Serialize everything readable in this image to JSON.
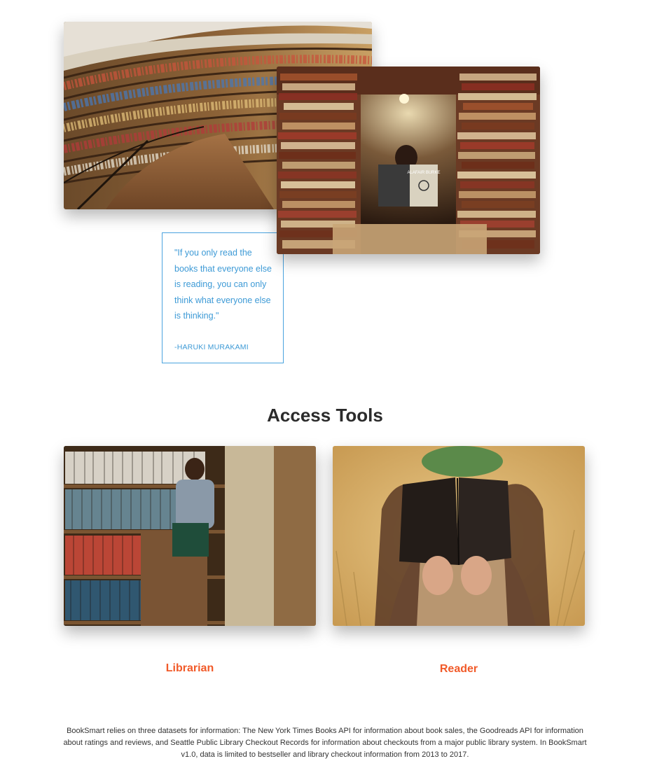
{
  "hero": {
    "image_library_hall": "photo of a curved library hall lined with bookshelves",
    "image_book_tunnel": "photo of a woman reading a book inside a tunnel of stacked books",
    "book_cover_text": "ALAFAIR BURKE"
  },
  "quote": {
    "text": "\"If you only read the books that everyone else is reading, you can only think what everyone else is thinking.\"",
    "author": "-HARUKI MURAKAMI"
  },
  "access_tools": {
    "title": "Access Tools",
    "tools": [
      {
        "label": "Librarian",
        "image": "librarian shelving books in a library"
      },
      {
        "label": "Reader",
        "image": "woman holding an open book in front of her face in a field"
      }
    ]
  },
  "footer": {
    "text": "BookSmart relies on three datasets for information: The New York Times Books API for information about book sales, the Goodreads API for information about ratings and reviews, and Seattle Public Library Checkout Records for information about checkouts from a major public library system. In BookSmart v1.0, data is limited to bestseller and library checkout information from 2013 to 2017."
  },
  "colors": {
    "accent": "#f15a29",
    "quote_blue": "#3d9ad6",
    "heading": "#2b2b2b"
  }
}
